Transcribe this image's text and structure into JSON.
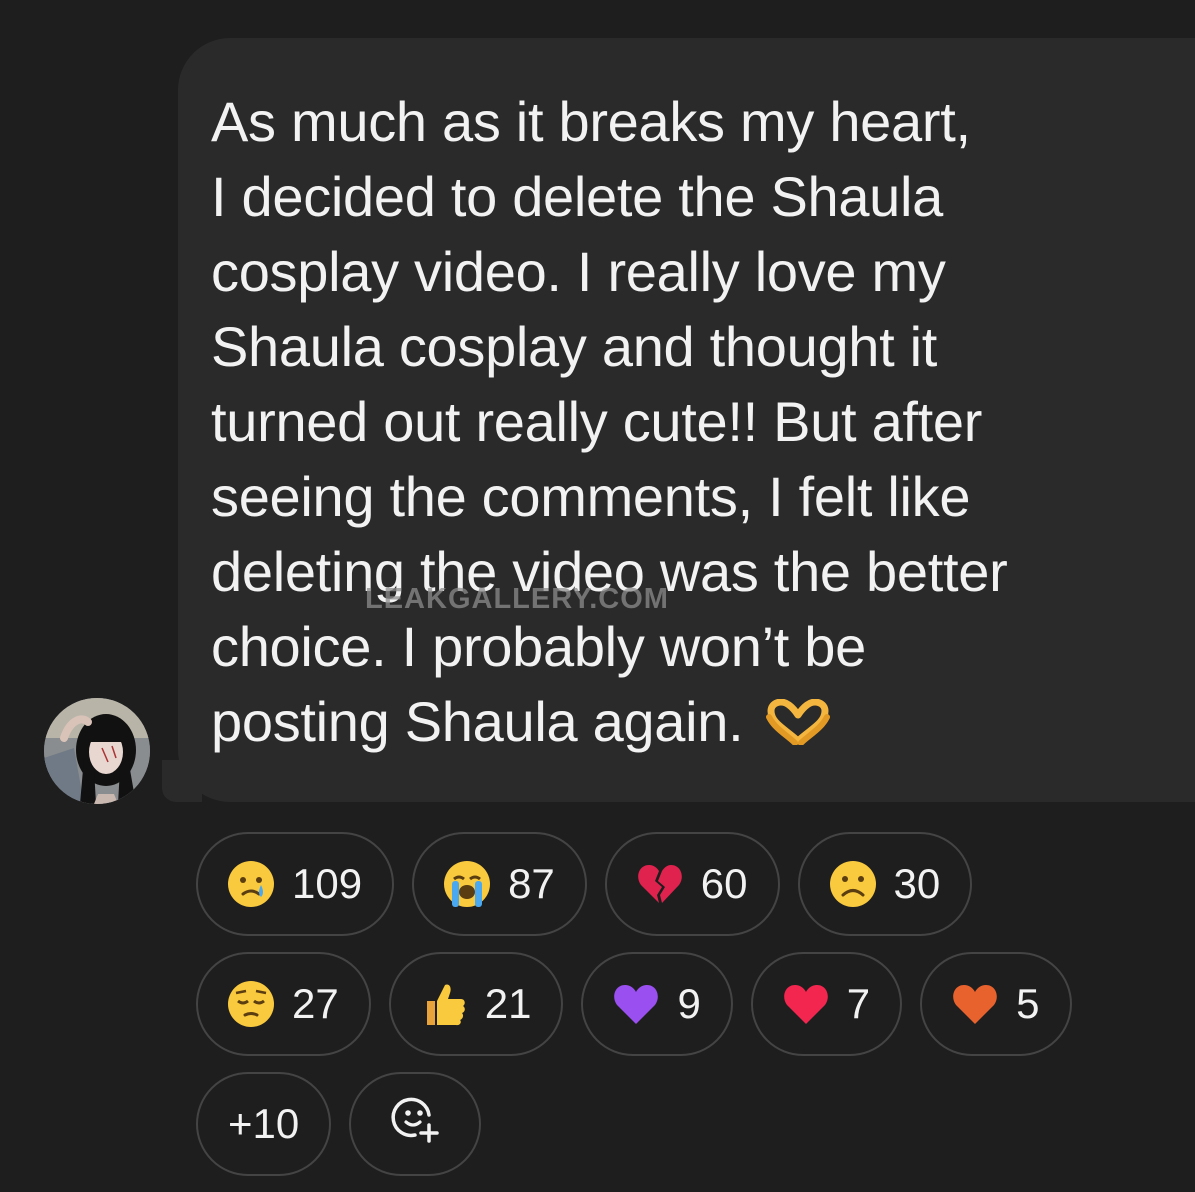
{
  "message": {
    "text": "As much as it breaks my heart,\nI decided to delete the Shaula\ncosplay video. I really love my\nShaula cosplay and thought it\nturned out really cute!! But after\nseeing the comments, I felt like\ndeleting the video was the better\nchoice. I probably won’t be\nposting Shaula again.",
    "trailing_emoji": "heart-hands-emoji"
  },
  "watermark": "LEAKGALLERY.COM",
  "avatar": {
    "icon": "user-avatar-photo"
  },
  "reactions": [
    {
      "emoji": "crying-face",
      "count": "109"
    },
    {
      "emoji": "loudly-crying-face",
      "count": "87"
    },
    {
      "emoji": "broken-heart",
      "count": "60"
    },
    {
      "emoji": "frowning-face",
      "count": "30"
    },
    {
      "emoji": "pensive-face",
      "count": "27"
    },
    {
      "emoji": "thumbs-up",
      "count": "21"
    },
    {
      "emoji": "purple-heart",
      "count": "9"
    },
    {
      "emoji": "red-heart",
      "count": "7"
    },
    {
      "emoji": "orange-heart",
      "count": "5"
    }
  ],
  "more_reactions": "+10",
  "add_reaction_icon": "add-reaction-icon",
  "colors": {
    "background": "#1e1e1e",
    "bubble": "#2a2a2a",
    "text": "#f2f2f2",
    "pill_border": "#444444"
  }
}
